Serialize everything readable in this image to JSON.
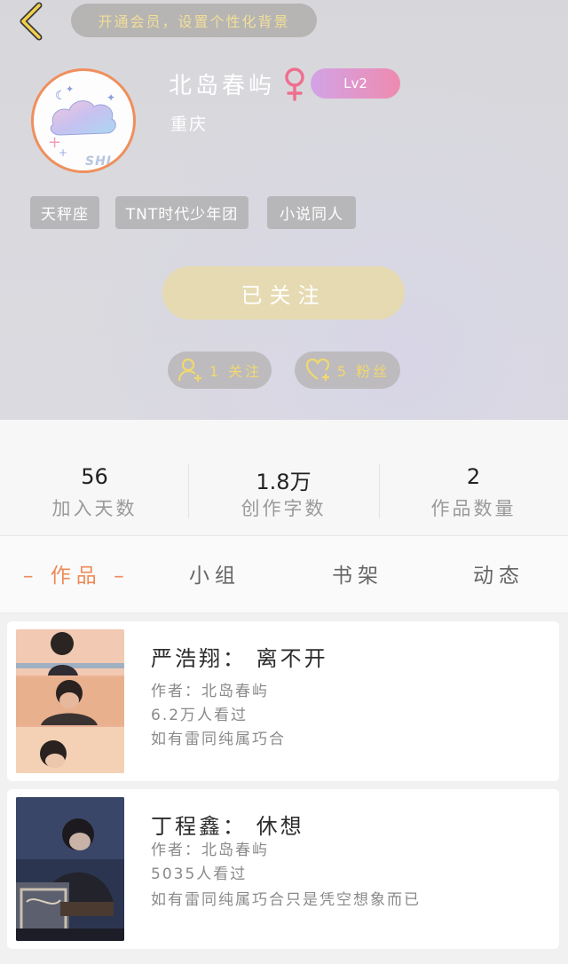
{
  "header": {
    "vip_banner": "开通会员，设置个性化背景",
    "avatar_text": "SHI",
    "username": "北岛春屿",
    "level": "Lv2",
    "location": "重庆",
    "tags": [
      "天秤座",
      "TNT时代少年团",
      "小说同人"
    ],
    "follow_button": "已关注",
    "following": "1 关注",
    "fans": "5 粉丝"
  },
  "stats": [
    {
      "value": "56",
      "label": "加入天数"
    },
    {
      "value": "1.8万",
      "label": "创作字数"
    },
    {
      "value": "2",
      "label": "作品数量"
    }
  ],
  "tabs": [
    "– 作品 –",
    "小组",
    "书架",
    "动态"
  ],
  "works": [
    {
      "title": "严浩翔： 离不开",
      "author": "作者：北岛春屿",
      "views": "6.2万人看过",
      "desc": "如有雷同纯属巧合"
    },
    {
      "title": "丁程鑫： 休想",
      "author": "作者：北岛春屿",
      "views": "5035人看过",
      "desc": "如有雷同纯属巧合只是凭空想象而已"
    }
  ],
  "colors": {
    "accent": "#ef8b57",
    "gold": "#f1d870",
    "follow_btn": "#e6dab2",
    "level_start": "#d3a3e6",
    "level_end": "#ee8bb0"
  },
  "icons": {
    "back": "chevron-left-icon",
    "gender": "female-icon",
    "following": "user-plus-icon",
    "fans": "heart-plus-icon"
  }
}
